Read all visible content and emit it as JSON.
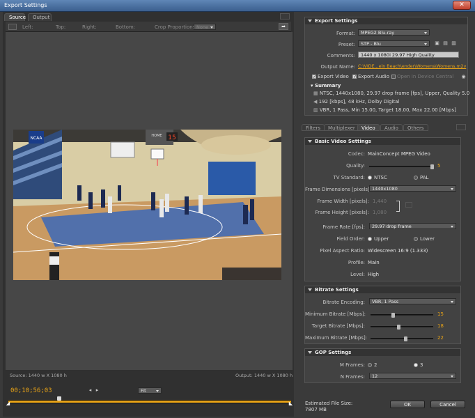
{
  "window": {
    "title": "Export Settings",
    "close": "✕"
  },
  "left": {
    "tabs": [
      "Source",
      "Output"
    ],
    "crop": {
      "left": "Left:",
      "top": "Top:",
      "right": "Right:",
      "bottom": "Bottom:",
      "crop_proportions": "Crop Proportions:",
      "proportion_value": "None"
    },
    "source_info": "Source: 1440 w X 1080 h",
    "output_info": "Output: 1440 w X 1080 h",
    "timecode": "00;10;56;03",
    "fit": "Fit",
    "scoreboard": "15",
    "scoreboard_label": "HOME",
    "banner": "NCAA",
    "playhead_percent": 18
  },
  "export": {
    "header": "Export Settings",
    "format_label": "Format:",
    "format_value": "MPEG2 Blu-ray",
    "preset_label": "Preset:",
    "preset_value": "STP - Blu",
    "comments_label": "Comments:",
    "comments_value": "1440 x 1080i 29.97 High Quality",
    "output_name_label": "Output Name:",
    "output_name_value": "C:\\VIDE...eln Beach\\ender\\Womens\\Womens.m2v",
    "export_video": "Export Video",
    "export_audio": "Export Audio",
    "open_device": "Open in Device Central",
    "summary_header": "Summary",
    "summary_lines": [
      "NTSC, 1440x1080, 29.97 drop frame [fps], Upper, Quality 5.0",
      "192 [kbps], 48 kHz, Dolby Digital",
      "VBR, 1 Pass, Min 15.00, Target 18.00, Max 22.00 [Mbps]"
    ]
  },
  "rtabs": [
    "Filters",
    "Multiplexer",
    "Video",
    "Audio",
    "Others"
  ],
  "video": {
    "header": "Basic Video Settings",
    "codec_label": "Codec:",
    "codec_value": "MainConcept MPEG Video",
    "quality_label": "Quality:",
    "quality_value": "5",
    "tv_label": "TV Standard:",
    "ntsc": "NTSC",
    "pal": "PAL",
    "frame_dim_label": "Frame Dimensions [pixels]:",
    "frame_dim_value": "1440x1080",
    "frame_width_label": "Frame Width [pixels]:",
    "frame_width_value": "1,440",
    "frame_height_label": "Frame Height [pixels]:",
    "frame_height_value": "1,080",
    "frame_rate_label": "Frame Rate [fps]:",
    "frame_rate_value": "29.97 drop frame",
    "field_order_label": "Field Order:",
    "upper": "Upper",
    "lower": "Lower",
    "par_label": "Pixel Aspect Ratio:",
    "par_value": "Widescreen 16:9 (1.333)",
    "profile_label": "Profile:",
    "profile_value": "Main",
    "level_label": "Level:",
    "level_value": "High"
  },
  "bitrate": {
    "header": "Bitrate Settings",
    "enc_label": "Bitrate Encoding:",
    "enc_value": "VBR, 1 Pass",
    "min_label": "Minimum Bitrate [Mbps]:",
    "min_value": "15",
    "target_label": "Target Bitrate [Mbps]:",
    "target_value": "18",
    "max_label": "Maximum Bitrate [Mbps]:",
    "max_value": "22"
  },
  "gop": {
    "header": "GOP Settings",
    "m_label": "M Frames:",
    "m_opt1": "2",
    "m_opt2": "3",
    "n_label": "N Frames:",
    "n_value": "12"
  },
  "footer": {
    "size_label": "Estimated File Size:",
    "size_value": "7807 MB",
    "ok": "OK",
    "cancel": "Cancel"
  }
}
